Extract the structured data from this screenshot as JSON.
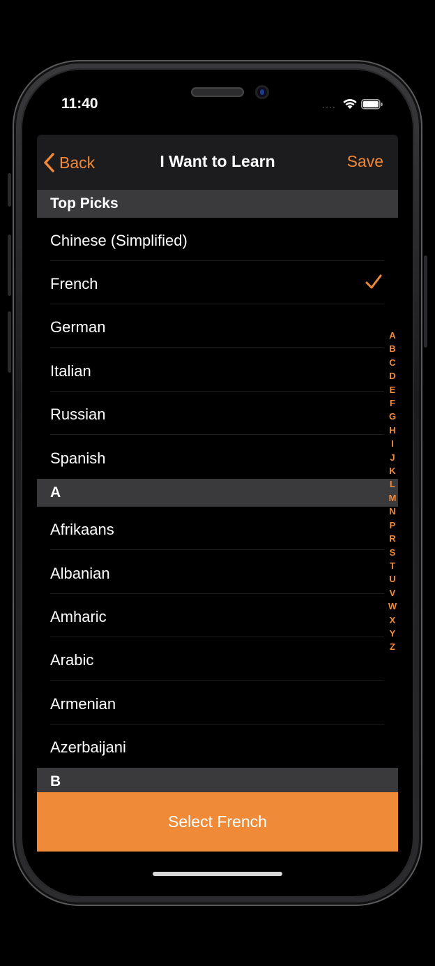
{
  "status_bar": {
    "time": "11:40"
  },
  "nav": {
    "back_label": "Back",
    "title": "I Want to Learn",
    "save_label": "Save"
  },
  "sections": {
    "top_picks": {
      "header": "Top Picks",
      "items": [
        "Chinese (Simplified)",
        "French",
        "German",
        "Italian",
        "Russian",
        "Spanish"
      ],
      "selected": "French"
    },
    "a": {
      "header": "A",
      "items": [
        "Afrikaans",
        "Albanian",
        "Amharic",
        "Arabic",
        "Armenian",
        "Azerbaijani"
      ]
    },
    "b": {
      "header": "B"
    }
  },
  "section_index": [
    "A",
    "B",
    "C",
    "D",
    "E",
    "F",
    "G",
    "H",
    "I",
    "J",
    "K",
    "L",
    "M",
    "N",
    "P",
    "R",
    "S",
    "T",
    "U",
    "V",
    "W",
    "X",
    "Y",
    "Z"
  ],
  "select_button": {
    "label": "Select French"
  },
  "colors": {
    "accent": "#ef8a38",
    "background": "#000000",
    "section_header": "#3a3a3c",
    "nav_bar": "#1c1c1e"
  },
  "icons": {
    "back": "chevron-left-icon",
    "selected": "checkmark-icon",
    "wifi": "wifi-icon",
    "battery": "battery-icon"
  }
}
